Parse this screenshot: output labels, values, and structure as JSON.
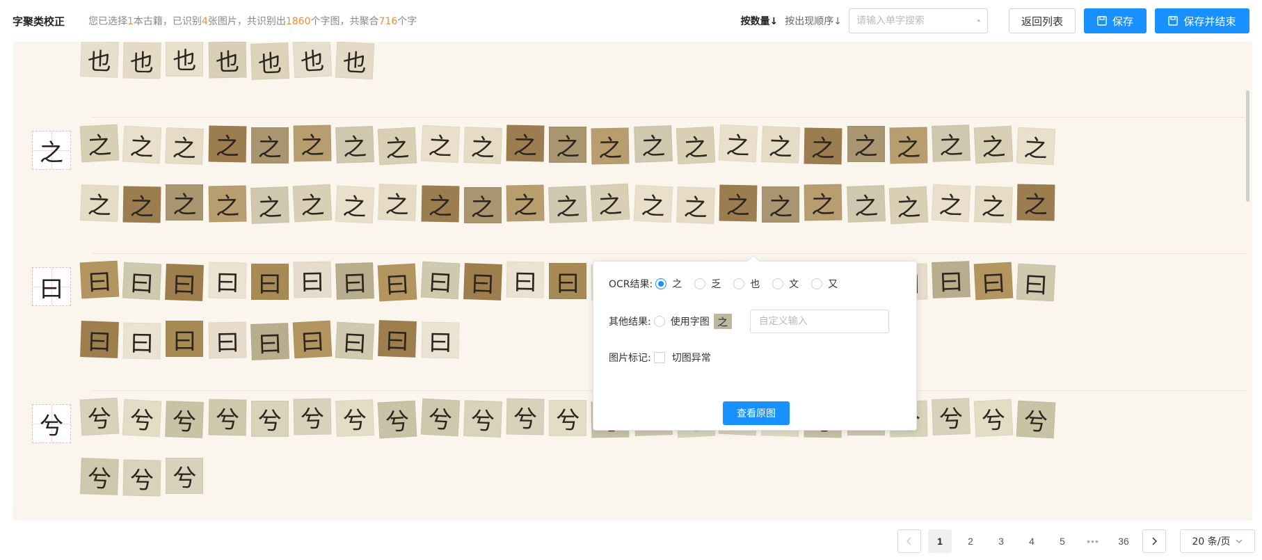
{
  "header": {
    "title": "字聚类校正",
    "summary": {
      "p1": "您已选择",
      "books": "1",
      "p2": "本古籍，已识别",
      "images": "4",
      "p3": "张图片，共识别出",
      "glyphs": "1860",
      "p4": "个字图，共聚合",
      "chars": "716",
      "p5": "个字"
    },
    "sort_by_count": "按数量↓",
    "sort_by_order": "按出现顺序↓",
    "search_placeholder": "请输入单字搜索",
    "back_label": "返回列表",
    "save_label": "保存",
    "save_end_label": "保存并结束"
  },
  "groups": [
    {
      "char": "也",
      "count": 30
    },
    {
      "char": "之",
      "count": 46
    },
    {
      "char": "曰",
      "count": 32
    },
    {
      "char": "兮",
      "count": 26
    }
  ],
  "popover": {
    "ocr_label": "OCR结果:",
    "ocr_options": [
      "之",
      "乏",
      "也",
      "文",
      "又"
    ],
    "ocr_selected": "之",
    "other_label": "其他结果:",
    "use_glyph_label": "使用字图",
    "use_glyph_thumb": "之",
    "custom_placeholder": "自定义输入",
    "mark_label": "图片标记:",
    "mark_option": "切图异常",
    "view_original": "查看原图"
  },
  "pagination": {
    "pages": [
      "1",
      "2",
      "3",
      "4",
      "5"
    ],
    "current": "1",
    "ellipsis": "•••",
    "last": "36",
    "page_size": "20 条/页"
  },
  "colors": {
    "accent": "#1890ff",
    "number_highlight": "#f08c3a",
    "content_bg": "#faf6ee"
  }
}
